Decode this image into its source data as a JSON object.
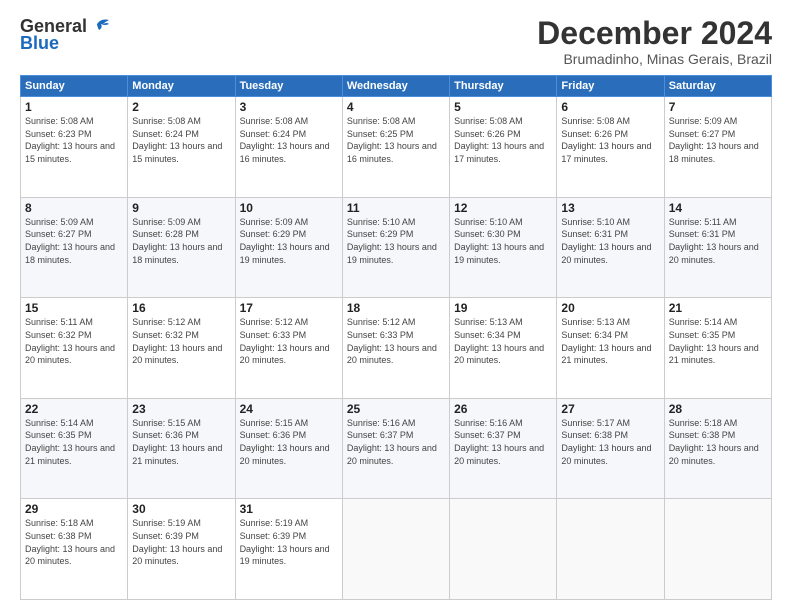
{
  "header": {
    "logo_general": "General",
    "logo_blue": "Blue",
    "month_title": "December 2024",
    "subtitle": "Brumadinho, Minas Gerais, Brazil"
  },
  "weekdays": [
    "Sunday",
    "Monday",
    "Tuesday",
    "Wednesday",
    "Thursday",
    "Friday",
    "Saturday"
  ],
  "weeks": [
    [
      {
        "day": "1",
        "sunrise": "5:08 AM",
        "sunset": "6:23 PM",
        "daylight": "13 hours and 15 minutes."
      },
      {
        "day": "2",
        "sunrise": "5:08 AM",
        "sunset": "6:24 PM",
        "daylight": "13 hours and 15 minutes."
      },
      {
        "day": "3",
        "sunrise": "5:08 AM",
        "sunset": "6:24 PM",
        "daylight": "13 hours and 16 minutes."
      },
      {
        "day": "4",
        "sunrise": "5:08 AM",
        "sunset": "6:25 PM",
        "daylight": "13 hours and 16 minutes."
      },
      {
        "day": "5",
        "sunrise": "5:08 AM",
        "sunset": "6:26 PM",
        "daylight": "13 hours and 17 minutes."
      },
      {
        "day": "6",
        "sunrise": "5:08 AM",
        "sunset": "6:26 PM",
        "daylight": "13 hours and 17 minutes."
      },
      {
        "day": "7",
        "sunrise": "5:09 AM",
        "sunset": "6:27 PM",
        "daylight": "13 hours and 18 minutes."
      }
    ],
    [
      {
        "day": "8",
        "sunrise": "5:09 AM",
        "sunset": "6:27 PM",
        "daylight": "13 hours and 18 minutes."
      },
      {
        "day": "9",
        "sunrise": "5:09 AM",
        "sunset": "6:28 PM",
        "daylight": "13 hours and 18 minutes."
      },
      {
        "day": "10",
        "sunrise": "5:09 AM",
        "sunset": "6:29 PM",
        "daylight": "13 hours and 19 minutes."
      },
      {
        "day": "11",
        "sunrise": "5:10 AM",
        "sunset": "6:29 PM",
        "daylight": "13 hours and 19 minutes."
      },
      {
        "day": "12",
        "sunrise": "5:10 AM",
        "sunset": "6:30 PM",
        "daylight": "13 hours and 19 minutes."
      },
      {
        "day": "13",
        "sunrise": "5:10 AM",
        "sunset": "6:31 PM",
        "daylight": "13 hours and 20 minutes."
      },
      {
        "day": "14",
        "sunrise": "5:11 AM",
        "sunset": "6:31 PM",
        "daylight": "13 hours and 20 minutes."
      }
    ],
    [
      {
        "day": "15",
        "sunrise": "5:11 AM",
        "sunset": "6:32 PM",
        "daylight": "13 hours and 20 minutes."
      },
      {
        "day": "16",
        "sunrise": "5:12 AM",
        "sunset": "6:32 PM",
        "daylight": "13 hours and 20 minutes."
      },
      {
        "day": "17",
        "sunrise": "5:12 AM",
        "sunset": "6:33 PM",
        "daylight": "13 hours and 20 minutes."
      },
      {
        "day": "18",
        "sunrise": "5:12 AM",
        "sunset": "6:33 PM",
        "daylight": "13 hours and 20 minutes."
      },
      {
        "day": "19",
        "sunrise": "5:13 AM",
        "sunset": "6:34 PM",
        "daylight": "13 hours and 20 minutes."
      },
      {
        "day": "20",
        "sunrise": "5:13 AM",
        "sunset": "6:34 PM",
        "daylight": "13 hours and 21 minutes."
      },
      {
        "day": "21",
        "sunrise": "5:14 AM",
        "sunset": "6:35 PM",
        "daylight": "13 hours and 21 minutes."
      }
    ],
    [
      {
        "day": "22",
        "sunrise": "5:14 AM",
        "sunset": "6:35 PM",
        "daylight": "13 hours and 21 minutes."
      },
      {
        "day": "23",
        "sunrise": "5:15 AM",
        "sunset": "6:36 PM",
        "daylight": "13 hours and 21 minutes."
      },
      {
        "day": "24",
        "sunrise": "5:15 AM",
        "sunset": "6:36 PM",
        "daylight": "13 hours and 20 minutes."
      },
      {
        "day": "25",
        "sunrise": "5:16 AM",
        "sunset": "6:37 PM",
        "daylight": "13 hours and 20 minutes."
      },
      {
        "day": "26",
        "sunrise": "5:16 AM",
        "sunset": "6:37 PM",
        "daylight": "13 hours and 20 minutes."
      },
      {
        "day": "27",
        "sunrise": "5:17 AM",
        "sunset": "6:38 PM",
        "daylight": "13 hours and 20 minutes."
      },
      {
        "day": "28",
        "sunrise": "5:18 AM",
        "sunset": "6:38 PM",
        "daylight": "13 hours and 20 minutes."
      }
    ],
    [
      {
        "day": "29",
        "sunrise": "5:18 AM",
        "sunset": "6:38 PM",
        "daylight": "13 hours and 20 minutes."
      },
      {
        "day": "30",
        "sunrise": "5:19 AM",
        "sunset": "6:39 PM",
        "daylight": "13 hours and 20 minutes."
      },
      {
        "day": "31",
        "sunrise": "5:19 AM",
        "sunset": "6:39 PM",
        "daylight": "13 hours and 19 minutes."
      },
      null,
      null,
      null,
      null
    ]
  ]
}
